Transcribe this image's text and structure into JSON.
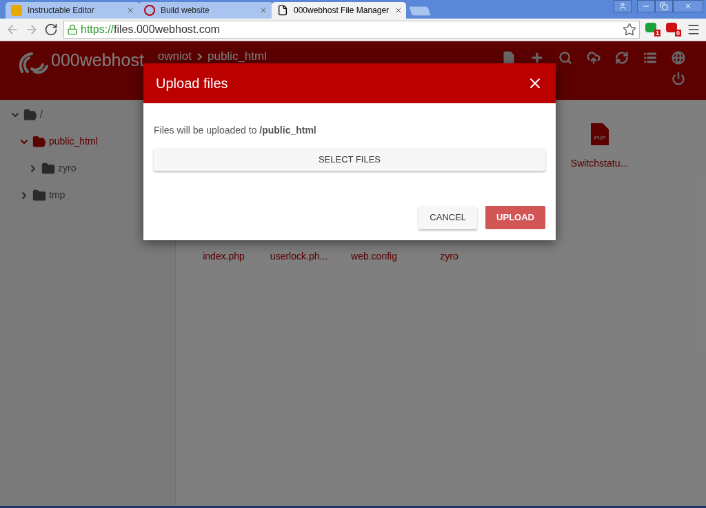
{
  "browser": {
    "tabs": [
      {
        "title": "Instructable Editor",
        "selected": false
      },
      {
        "title": "Build website",
        "selected": false
      },
      {
        "title": "000webhost File Manager",
        "selected": true
      }
    ],
    "url": {
      "scheme": "https://",
      "rest": "files.000webhost.com"
    },
    "extensions": [
      {
        "badge": "1",
        "color": "#1aa33b"
      },
      {
        "badge": "0",
        "color": "#cc1111"
      }
    ]
  },
  "header": {
    "logo": "000webhost",
    "breadcrumb": [
      "owniot",
      "public_html"
    ]
  },
  "tree": [
    {
      "name": "/",
      "expanded": true,
      "selected": false,
      "children": [
        {
          "name": "public_html",
          "expanded": true,
          "selected": true,
          "children": [
            {
              "name": "zyro",
              "expanded": false,
              "selected": false
            }
          ]
        },
        {
          "name": "tmp",
          "expanded": false,
          "selected": false
        }
      ]
    }
  ],
  "files": [
    {
      "name": "Switchstatu...",
      "kind": "php",
      "icon_label": "PHP"
    },
    {
      "name": "index.php",
      "kind": "hidden"
    },
    {
      "name": "userlock.ph...",
      "kind": "hidden"
    },
    {
      "name": "web.config",
      "kind": "hidden"
    },
    {
      "name": "zyro",
      "kind": "hidden"
    }
  ],
  "dialog": {
    "title": "Upload files",
    "message": "Files will be uploaded to **/public_html**",
    "select_button": "SELECT FILES",
    "cancel_button": "CANCEL",
    "upload_button": "UPLOAD"
  }
}
